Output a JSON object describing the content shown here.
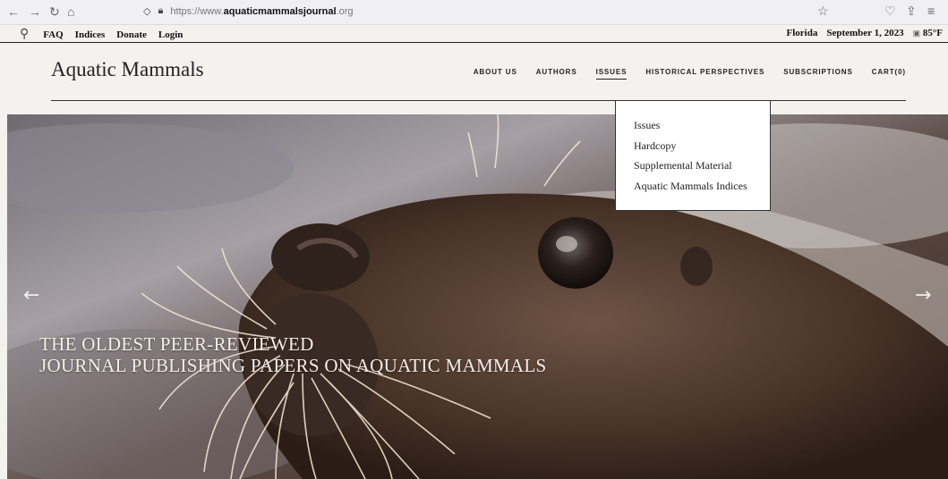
{
  "browser": {
    "url_prefix": "https://www.",
    "url_domain": "aquaticmammalsjournal",
    "url_suffix": ".org"
  },
  "util_bar": {
    "links": [
      "FAQ",
      "Indices",
      "Donate",
      "Login"
    ],
    "location": "Florida",
    "date": "September 1, 2023",
    "temperature": "85°F"
  },
  "header": {
    "title": "Aquatic Mammals",
    "nav": [
      "ABOUT US",
      "AUTHORS",
      "ISSUES",
      "HISTORICAL PERSPECTIVES",
      "SUBSCRIPTIONS",
      "CART(0)"
    ]
  },
  "dropdown": {
    "items": [
      "Issues",
      "Hardcopy",
      "Supplemental Material",
      "Aquatic Mammals Indices"
    ]
  },
  "hero": {
    "line1": "THE OLDEST PEER-REVIEWED",
    "line2": "JOURNAL PUBLISHING PAPERS ON AQUATIC MAMMALS"
  },
  "icons": {
    "back": "arrow-left-icon",
    "forward": "arrow-right-icon",
    "reload": "reload-icon",
    "home": "home-icon",
    "shield": "shield-icon",
    "lock": "lock-icon",
    "bookmark": "star-icon",
    "pocket": "pocket-icon",
    "share": "share-icon",
    "menu": "menu-icon",
    "search": "search-icon",
    "prev": "chevron-left-icon",
    "next": "chevron-right-icon"
  },
  "colors": {
    "page_bg": "#f3f2ef",
    "text": "#222222",
    "dropdown_bg": "#ffffff"
  }
}
